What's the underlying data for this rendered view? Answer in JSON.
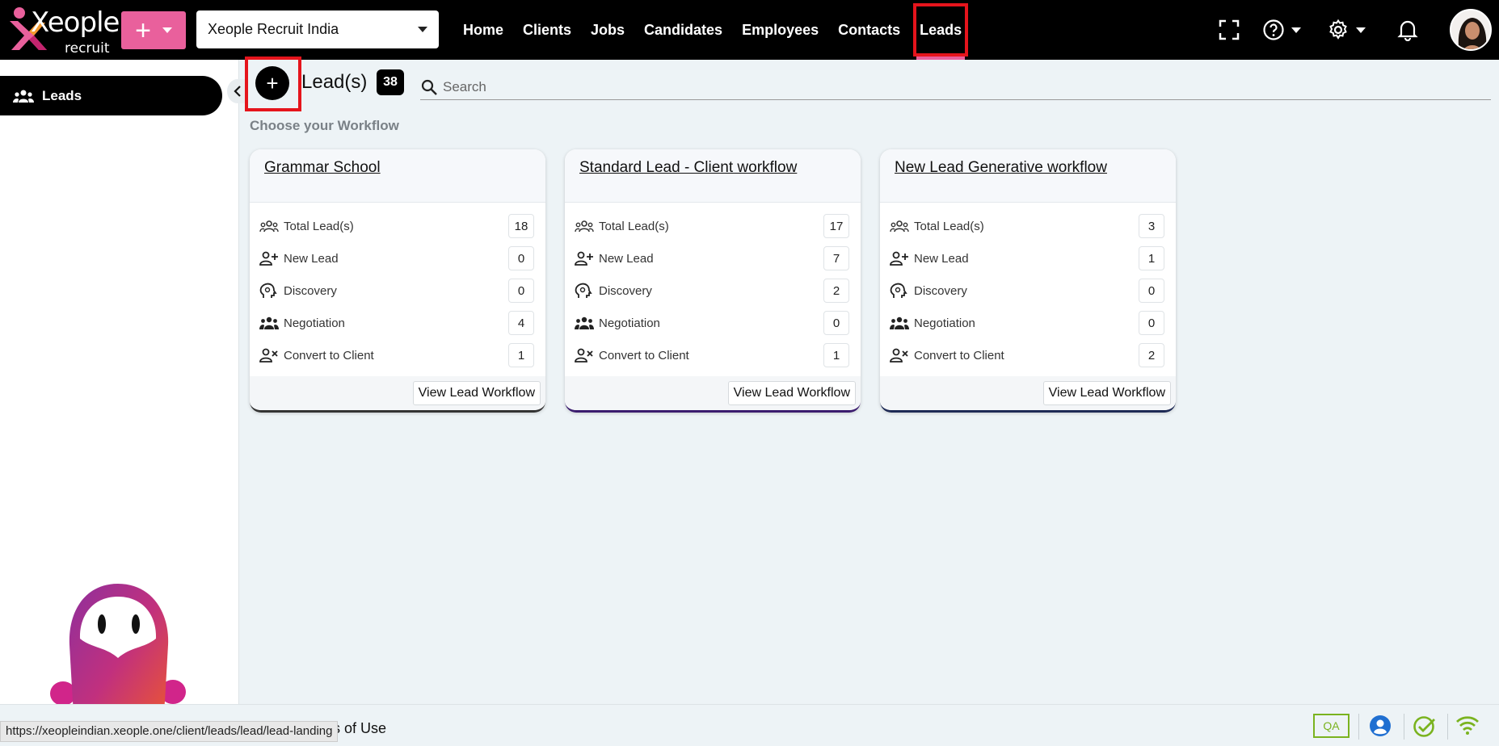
{
  "brand": {
    "name": "Xeople",
    "sub": "recruit"
  },
  "topbar": {
    "company": "Xeople Recruit India",
    "nav": [
      {
        "label": "Home"
      },
      {
        "label": "Clients"
      },
      {
        "label": "Jobs"
      },
      {
        "label": "Candidates"
      },
      {
        "label": "Employees"
      },
      {
        "label": "Contacts"
      },
      {
        "label": "Leads",
        "active": true
      }
    ],
    "icons": [
      "fullscreen-icon",
      "help-icon",
      "gear-icon",
      "bell-icon"
    ]
  },
  "sidebar": {
    "items": [
      {
        "label": "Leads",
        "icon": "people-icon"
      }
    ]
  },
  "header": {
    "title": "Lead(s)",
    "count": "38",
    "search_placeholder": "Search",
    "section_title": "Choose your Workflow"
  },
  "cards": [
    {
      "title": "Grammar School",
      "rows": [
        {
          "label": "Total Lead(s)",
          "value": "18"
        },
        {
          "label": "New Lead",
          "value": "0"
        },
        {
          "label": "Discovery",
          "value": "0"
        },
        {
          "label": "Negotiation",
          "value": "4"
        },
        {
          "label": "Convert to Client",
          "value": "1"
        }
      ],
      "button": "View Lead Workflow",
      "accent": "#333333"
    },
    {
      "title": "Standard Lead - Client workflow",
      "rows": [
        {
          "label": "Total Lead(s)",
          "value": "17"
        },
        {
          "label": "New Lead",
          "value": "7"
        },
        {
          "label": "Discovery",
          "value": "2"
        },
        {
          "label": "Negotiation",
          "value": "0"
        },
        {
          "label": "Convert to Client",
          "value": "1"
        }
      ],
      "button": "View Lead Workflow",
      "accent": "#3b1c6e"
    },
    {
      "title": "New Lead Generative workflow",
      "rows": [
        {
          "label": "Total Lead(s)",
          "value": "3"
        },
        {
          "label": "New Lead",
          "value": "1"
        },
        {
          "label": "Discovery",
          "value": "0"
        },
        {
          "label": "Negotiation",
          "value": "0"
        },
        {
          "label": "Convert to Client",
          "value": "2"
        }
      ],
      "button": "View Lead Workflow",
      "accent": "#1e2a55"
    }
  ],
  "footer": {
    "terms": "ns of Use",
    "status_url": "https://xeopleindian.xeople.one/client/leads/lead/lead-landing",
    "qa": "QA"
  },
  "colors": {
    "accent_pink": "#e9609c",
    "highlight_red": "#e5141c",
    "qa_green": "#7ab31f",
    "user_blue": "#1f6fd1"
  }
}
